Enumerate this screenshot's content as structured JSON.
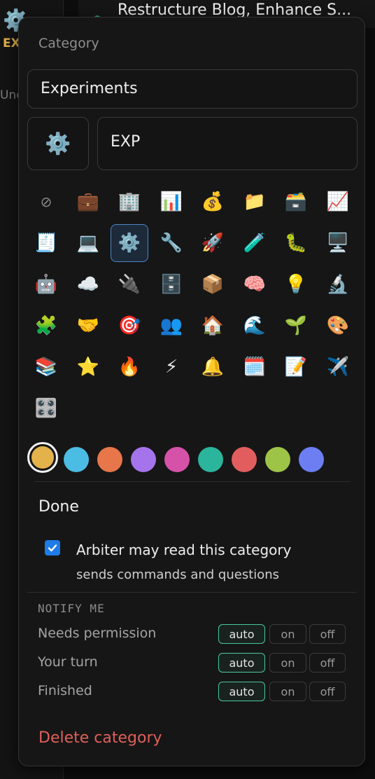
{
  "background": {
    "sidebar_abbr": "EX",
    "sidebar_other": "Unc",
    "header_title": "Restructure Blog, Enhance S..."
  },
  "panel": {
    "category_label": "Category",
    "name_value": "Experiments",
    "preview_icon": "⚙️",
    "abbr_value": "EXP",
    "icons": [
      {
        "glyph": "⊘",
        "name": "no-icon"
      },
      {
        "glyph": "💼",
        "name": "briefcase-icon"
      },
      {
        "glyph": "🏢",
        "name": "office-building-icon"
      },
      {
        "glyph": "📊",
        "name": "bar-chart-icon"
      },
      {
        "glyph": "💰",
        "name": "money-bag-icon"
      },
      {
        "glyph": "📁",
        "name": "folder-icon"
      },
      {
        "glyph": "🗃️",
        "name": "card-file-box-icon"
      },
      {
        "glyph": "📈",
        "name": "trend-up-icon"
      },
      {
        "glyph": "🧾",
        "name": "receipt-icon"
      },
      {
        "glyph": "💻",
        "name": "laptop-icon"
      },
      {
        "glyph": "⚙️",
        "name": "gear-icon"
      },
      {
        "glyph": "🔧",
        "name": "wrench-icon"
      },
      {
        "glyph": "🚀",
        "name": "rocket-icon"
      },
      {
        "glyph": "🧪",
        "name": "test-tube-icon"
      },
      {
        "glyph": "🐛",
        "name": "bug-icon"
      },
      {
        "glyph": "🖥️",
        "name": "desktop-computer-icon"
      },
      {
        "glyph": "🤖",
        "name": "robot-icon"
      },
      {
        "glyph": "☁️",
        "name": "cloud-icon"
      },
      {
        "glyph": "🔌",
        "name": "plug-icon"
      },
      {
        "glyph": "🗄️",
        "name": "file-cabinet-icon"
      },
      {
        "glyph": "📦",
        "name": "package-icon"
      },
      {
        "glyph": "🧠",
        "name": "brain-icon"
      },
      {
        "glyph": "💡",
        "name": "light-bulb-icon"
      },
      {
        "glyph": "🔬",
        "name": "microscope-icon"
      },
      {
        "glyph": "🧩",
        "name": "puzzle-icon"
      },
      {
        "glyph": "🤝",
        "name": "handshake-icon"
      },
      {
        "glyph": "🎯",
        "name": "target-icon"
      },
      {
        "glyph": "👥",
        "name": "people-icon"
      },
      {
        "glyph": "🏠",
        "name": "house-icon"
      },
      {
        "glyph": "🌊",
        "name": "wave-icon"
      },
      {
        "glyph": "🌱",
        "name": "seedling-icon"
      },
      {
        "glyph": "🎨",
        "name": "palette-icon"
      },
      {
        "glyph": "📚",
        "name": "books-icon"
      },
      {
        "glyph": "⭐",
        "name": "star-icon"
      },
      {
        "glyph": "🔥",
        "name": "fire-icon"
      },
      {
        "glyph": "⚡",
        "name": "lightning-icon"
      },
      {
        "glyph": "🔔",
        "name": "bell-icon"
      },
      {
        "glyph": "🗓️",
        "name": "calendar-icon"
      },
      {
        "glyph": "📝",
        "name": "memo-icon"
      },
      {
        "glyph": "✈️",
        "name": "airplane-icon"
      },
      {
        "glyph": "🎛️",
        "name": "control-knobs-icon"
      }
    ],
    "selected_icon_index": 10,
    "colors": [
      "#e3b24a",
      "#4bbce3",
      "#e7764a",
      "#a574ec",
      "#d552a8",
      "#2bb59c",
      "#e25e5e",
      "#9ec447",
      "#6d7ef2"
    ],
    "selected_color_index": 0,
    "done_label": "Done",
    "arbiter_checked": true,
    "arbiter_label": "Arbiter may read this category",
    "arbiter_sub": "sends commands and questions",
    "notify_heading": "NOTIFY ME",
    "notify_rows": [
      {
        "label": "Needs permission",
        "selected": "auto"
      },
      {
        "label": "Your turn",
        "selected": "auto"
      },
      {
        "label": "Finished",
        "selected": "auto"
      }
    ],
    "notify_options": [
      "auto",
      "on",
      "off"
    ],
    "delete_label": "Delete category"
  }
}
